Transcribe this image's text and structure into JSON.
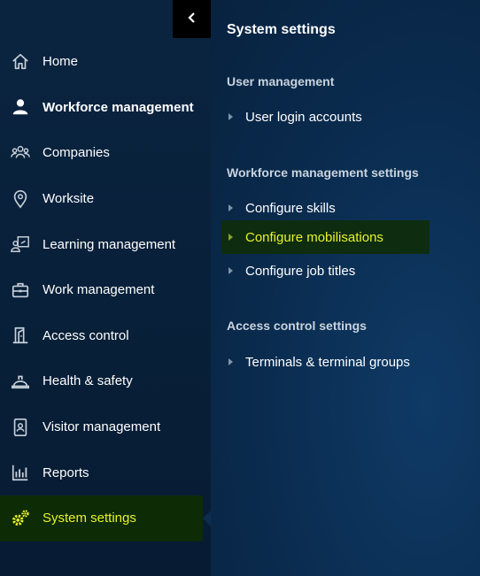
{
  "sidebar": {
    "collapse_icon": "chevron-left-icon",
    "items": [
      {
        "label": "Home",
        "icon": "home-icon"
      },
      {
        "label": "Workforce management",
        "icon": "person-icon"
      },
      {
        "label": "Companies",
        "icon": "group-icon"
      },
      {
        "label": "Worksite",
        "icon": "location-pin-icon"
      },
      {
        "label": "Learning management",
        "icon": "learning-icon"
      },
      {
        "label": "Work management",
        "icon": "briefcase-icon"
      },
      {
        "label": "Access control",
        "icon": "door-icon"
      },
      {
        "label": "Health & safety",
        "icon": "hard-hat-icon"
      },
      {
        "label": "Visitor management",
        "icon": "badge-icon"
      },
      {
        "label": "Reports",
        "icon": "bar-chart-icon"
      },
      {
        "label": "System settings",
        "icon": "gears-icon"
      }
    ],
    "active_item": "System settings"
  },
  "panel": {
    "title": "System settings",
    "sections": [
      {
        "title": "User management",
        "links": [
          "User login accounts"
        ]
      },
      {
        "title": "Workforce management settings",
        "links": [
          "Configure skills",
          "Configure mobilisations",
          "Configure job titles"
        ]
      },
      {
        "title": "Access control settings",
        "links": [
          "Terminals & terminal groups"
        ]
      }
    ],
    "active_link": "Configure mobilisations"
  },
  "colors": {
    "sidebar_bg": "#0a2440",
    "panel_bg": "#0a2b4e",
    "active_bg": "#0d2b05",
    "active_text": "#e8f22a",
    "text": "#ffffff"
  }
}
